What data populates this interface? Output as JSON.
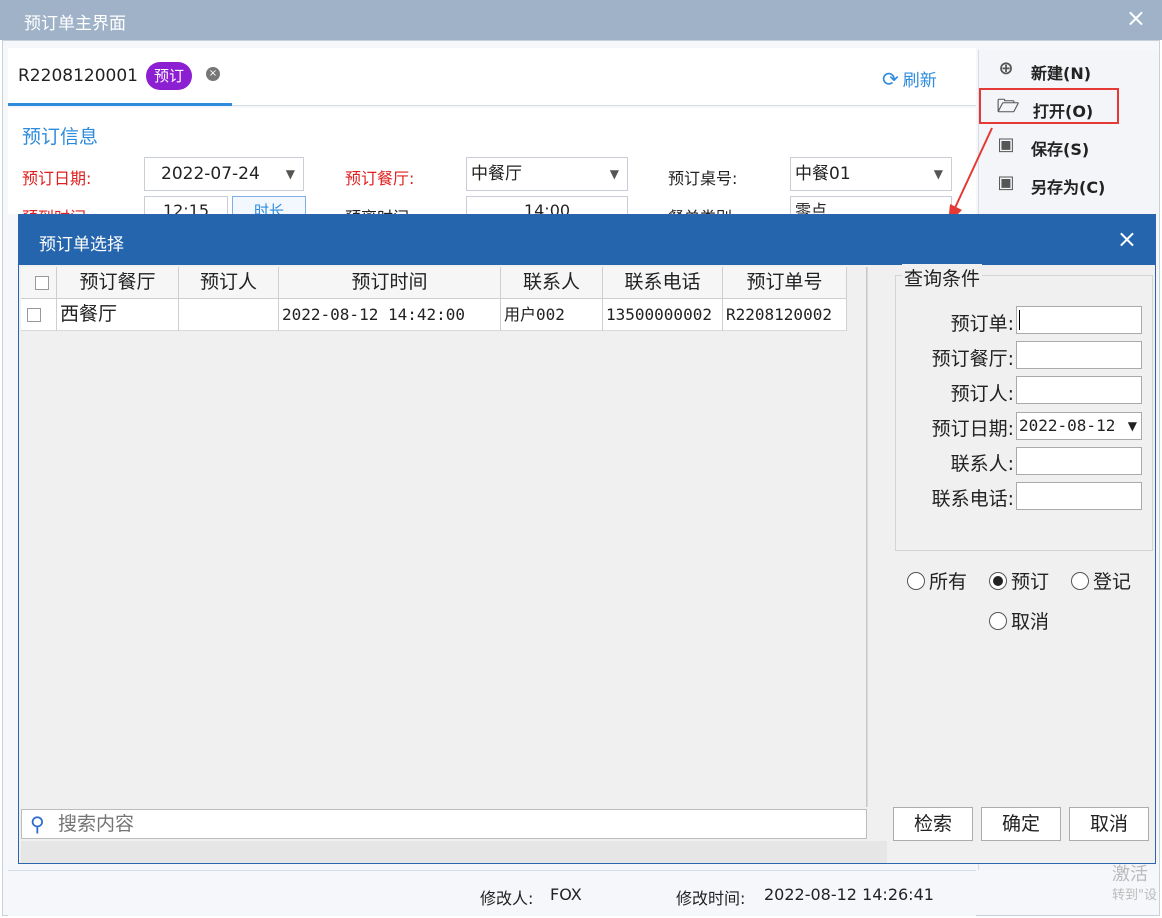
{
  "window": {
    "title": "预订单主界面",
    "close_glyph": "×"
  },
  "tab": {
    "number": "R2208120001",
    "badge": "预订",
    "close_glyph": "×"
  },
  "refresh_label": "刷新",
  "form": {
    "section_title": "预订信息",
    "reserve_date_label": "预订日期:",
    "reserve_date_value": "2022-07-24",
    "restaurant_label": "预订餐厅:",
    "restaurant_value": "中餐厅",
    "table_no_label": "预订桌号:",
    "table_no_value": "中餐01",
    "arrival_time_label": "预到时间:",
    "arrival_time_value": "12:15",
    "duration_button": "时长",
    "leave_time_label": "预离时间:",
    "leave_time_value": "14:00",
    "order_type_label": "餐单类别:",
    "order_type_value": "零点"
  },
  "toolbar": {
    "new_label": "新建(N)",
    "open_label": "打开(O)",
    "save_label": "保存(S)",
    "save_as_label": "另存为(C)"
  },
  "status": {
    "modifier_label": "修改人:",
    "modifier_value": "FOX",
    "modified_time_label": "修改时间:",
    "modified_time_value": "2022-08-12 14:26:41"
  },
  "watermark": {
    "line1": "激活",
    "line2": "转到\"设"
  },
  "dialog": {
    "title": "预订单选择",
    "close_glyph": "×",
    "columns": [
      "预订餐厅",
      "预订人",
      "预订时间",
      "联系人",
      "联系电话",
      "预订单号"
    ],
    "rows": [
      {
        "restaurant": "西餐厅",
        "person": "",
        "time": "2022-08-12 14:42:00",
        "contact": "用户002",
        "phone": "13500000002",
        "order_no": "R2208120002"
      }
    ],
    "search_placeholder": "搜索内容",
    "query": {
      "group_title": "查询条件",
      "order_label": "预订单:",
      "restaurant_label": "预订餐厅:",
      "person_label": "预订人:",
      "date_label": "预订日期:",
      "date_value": "2022-08-12",
      "contact_label": "联系人:",
      "phone_label": "联系电话:"
    },
    "status_filters": [
      {
        "label": "所有",
        "selected": false
      },
      {
        "label": "预订",
        "selected": true
      },
      {
        "label": "登记",
        "selected": false
      },
      {
        "label": "取消",
        "selected": false
      }
    ],
    "buttons": {
      "search": "检索",
      "ok": "确定",
      "cancel": "取消"
    }
  }
}
